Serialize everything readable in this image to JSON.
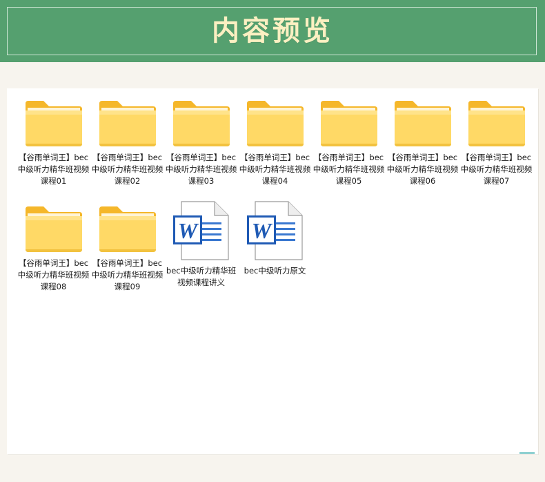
{
  "header": {
    "title": "内容预览"
  },
  "files": [
    {
      "type": "folder",
      "label": "【谷雨单词王】bec中级听力精华班视频课程01"
    },
    {
      "type": "folder",
      "label": "【谷雨单词王】bec中级听力精华班视频课程02"
    },
    {
      "type": "folder",
      "label": "【谷雨单词王】bec中级听力精华班视频课程03"
    },
    {
      "type": "folder",
      "label": "【谷雨单词王】bec中级听力精华班视频课程04"
    },
    {
      "type": "folder",
      "label": "【谷雨单词王】bec中级听力精华班视频课程05"
    },
    {
      "type": "folder",
      "label": "【谷雨单词王】bec中级听力精华班视频课程06"
    },
    {
      "type": "folder",
      "label": "【谷雨单词王】bec中级听力精华班视频课程07"
    },
    {
      "type": "folder",
      "label": "【谷雨单词王】bec中级听力精华班视频课程08"
    },
    {
      "type": "folder",
      "label": "【谷雨单词王】bec中级听力精华班视频课程09"
    },
    {
      "type": "word-document",
      "label": "bec中级听力精华班视频课程讲义"
    },
    {
      "type": "word-document",
      "label": "bec中级听力原文"
    }
  ],
  "icons": {
    "folder": "folder-icon",
    "word": "word-document-icon"
  },
  "colors": {
    "header_bg": "#55a06f",
    "title": "#fbf0c2",
    "folder_back": "#f5b72a",
    "folder_front": "#ffd966",
    "word_blue": "#1f5ab4"
  }
}
